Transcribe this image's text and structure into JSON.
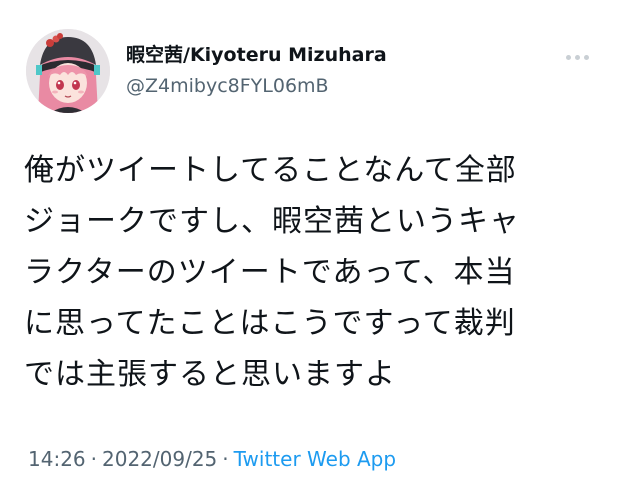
{
  "user": {
    "display_name": "暇空茜/Kiyoteru Mizuhara",
    "handle": "@Z4mibyc8FYL06mB",
    "avatar": "anime-girl-avatar"
  },
  "more_icon": "more-horizontal-icon",
  "tweet": {
    "text": "俺がツイートしてることなんて全部\nジョークですし、暇空茜というキャ\nラクターのツイートであって、本当\nに思ってたことはこうですって裁判\nでは主張すると思いますよ"
  },
  "meta": {
    "time": "14:26",
    "separator": "·",
    "date": "2022/09/25",
    "source": "Twitter Web App"
  },
  "colors": {
    "text": "#0f1419",
    "secondary": "#536471",
    "link": "#1d9bf0"
  }
}
